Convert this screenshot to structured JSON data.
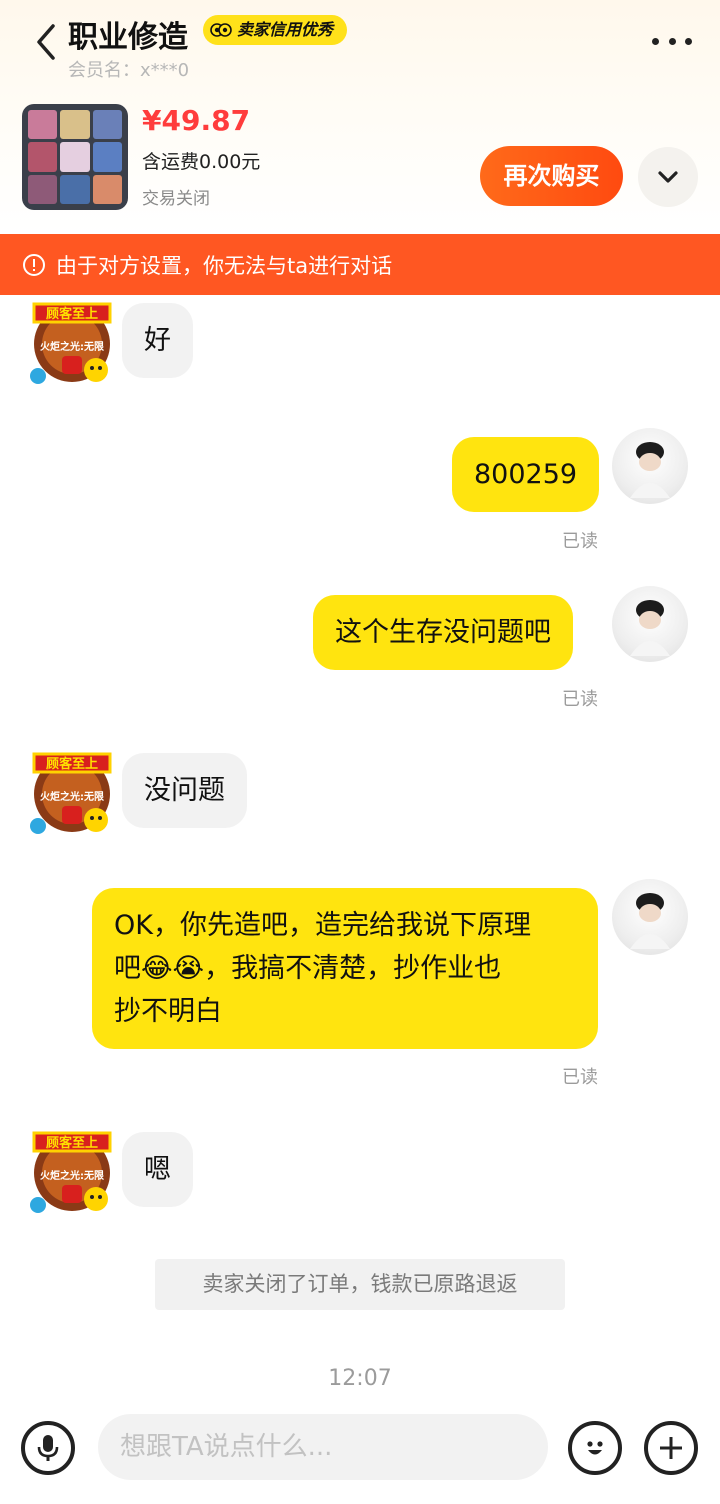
{
  "header": {
    "title": "职业修造",
    "badge_label": "卖家信用优秀",
    "member_label": "会员名：x***0"
  },
  "product": {
    "price": "¥49.87",
    "shipping": "含运费0.00元",
    "status": "交易关闭",
    "rebuy_label": "再次购买"
  },
  "notice": {
    "text": "由于对方设置，你无法与ta进行对话",
    "color": "#ff5722"
  },
  "avatar_badge": {
    "line1": "顾客至上",
    "line2": "火炬之光:无限"
  },
  "messages": [
    {
      "side": "left",
      "text": "好"
    },
    {
      "side": "right",
      "text": "800259",
      "read": "已读"
    },
    {
      "side": "right",
      "text": "这个生存没问题吧",
      "read": "已读"
    },
    {
      "side": "left",
      "text": "没问题"
    },
    {
      "side": "right",
      "line1": "OK，你先造吧，造完给我说下原理",
      "line2_before": "吧",
      "line2_after": "，我搞不清楚，抄作业也",
      "line3": "抄不明白",
      "emoji": "😂😭",
      "read": "已读"
    },
    {
      "side": "left",
      "text": "嗯"
    }
  ],
  "system_message": "卖家关闭了订单，钱款已原路退返",
  "timestamp": "12:07",
  "input": {
    "placeholder": "想跟TA说点什么..."
  },
  "colors": {
    "accent": "#ff4a10",
    "my_bubble": "#ffe40f",
    "price": "#ff3c3c"
  }
}
